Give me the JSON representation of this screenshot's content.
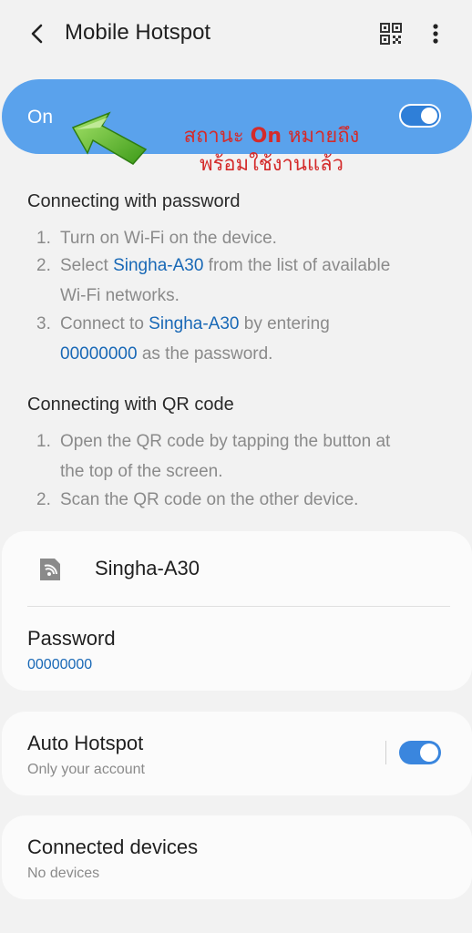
{
  "header": {
    "title": "Mobile Hotspot"
  },
  "status": {
    "label": "On",
    "enabled": true
  },
  "annotation": {
    "prefix": "สถานะ ",
    "keyword": "On",
    "suffix": " หมายถึง",
    "line2": "พร้อมใช้งานแล้ว",
    "color": "#d42b2b"
  },
  "password_section": {
    "title": "Connecting with password",
    "steps": [
      {
        "num": "1.",
        "text": "Turn on Wi-Fi on the device."
      },
      {
        "num": "2.",
        "a": "Select ",
        "link": "Singha-A30",
        "b": " from the list of available",
        "c": "Wi-Fi networks."
      },
      {
        "num": "3.",
        "a": "Connect to ",
        "link": "Singha-A30",
        "b": " by entering",
        "pwd": "00000000",
        "c": " as the password."
      }
    ]
  },
  "qr_section": {
    "title": "Connecting with QR code",
    "steps": [
      {
        "num": "1.",
        "text": "Open the QR code by tapping the button at",
        "text2": "the top of the screen."
      },
      {
        "num": "2.",
        "text": "Scan the QR code on the other device."
      }
    ]
  },
  "network": {
    "name": "Singha-A30",
    "password_label": "Password",
    "password_value": "00000000"
  },
  "auto_hotspot": {
    "title": "Auto Hotspot",
    "subtitle": "Only your account",
    "enabled": true
  },
  "connected": {
    "title": "Connected devices",
    "subtitle": "No devices"
  },
  "colors": {
    "accent": "#3a86de",
    "link": "#1868b6",
    "on_bar": "#5aa2ec"
  }
}
